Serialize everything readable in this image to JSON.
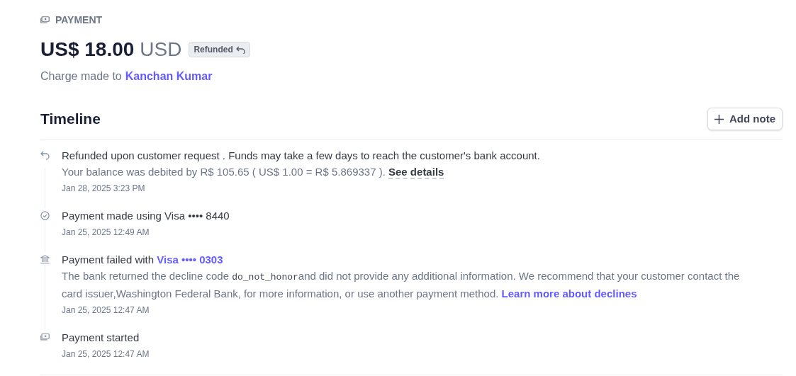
{
  "header": {
    "eyebrow": "PAYMENT",
    "amount": "US$ 18.00",
    "currency": "USD",
    "status_badge": "Refunded",
    "charge_prefix": "Charge made to",
    "customer": "Kanchan Kumar"
  },
  "timeline": {
    "title": "Timeline",
    "add_button": "Add note",
    "events": [
      {
        "kind": "refund",
        "title": [
          {
            "kind": "plain",
            "text": "Refunded upon customer request . Funds may take a few days to reach the customer's bank account."
          }
        ],
        "detail": [
          {
            "kind": "plain",
            "text": "Your balance was debited by R$ 105.65 ( US$ 1.00 = R$ 5.869337 ). "
          },
          {
            "kind": "dotted",
            "text": "See details"
          }
        ],
        "time": "Jan 28, 2025 3:23 PM"
      },
      {
        "kind": "success",
        "title": [
          {
            "kind": "plain",
            "text": "Payment made using Visa •••• 8440"
          }
        ],
        "time": "Jan 25, 2025 12:49 AM"
      },
      {
        "kind": "bank",
        "title": [
          {
            "kind": "plain",
            "text": "Payment failed with "
          },
          {
            "kind": "link",
            "text": "Visa •••• 0303"
          }
        ],
        "detail": [
          {
            "kind": "plain",
            "text": "The bank returned the decline code "
          },
          {
            "kind": "code",
            "text": "do_not_honor"
          },
          {
            "kind": "plain",
            "text": "and did not provide any additional information. We recommend that your customer contact the card issuer,Washington Federal Bank, for more information, or use another payment method. "
          },
          {
            "kind": "link",
            "text": "Learn more about declines"
          }
        ],
        "time": "Jan 25, 2025 12:47 AM"
      },
      {
        "kind": "started",
        "title": [
          {
            "kind": "plain",
            "text": "Payment started"
          }
        ],
        "time": "Jan 25, 2025 12:47 AM"
      }
    ]
  }
}
